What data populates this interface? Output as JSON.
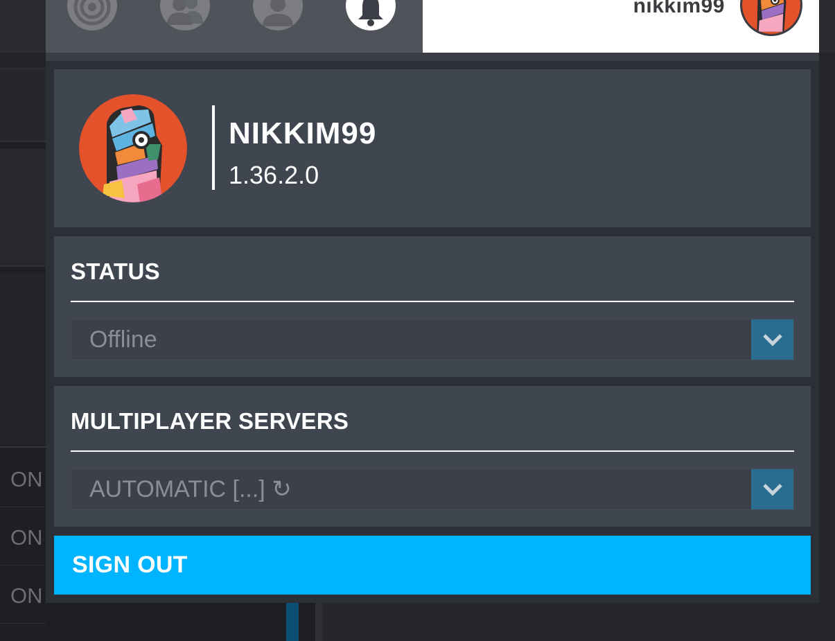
{
  "header": {
    "username": "nikkim99",
    "nav_icons": [
      "target-icon",
      "friends-icon",
      "profile-icon",
      "notifications-icon"
    ],
    "active_nav": "notifications-icon"
  },
  "profile": {
    "gamertag": "NIKKIM99",
    "version": "1.36.2.0"
  },
  "status": {
    "title": "STATUS",
    "selected": "Offline"
  },
  "multiplayer": {
    "title": "MULTIPLAYER SERVERS",
    "selected": "AUTOMATIC [...] ↻"
  },
  "sign_out": {
    "label": "SIGN OUT"
  },
  "background": {
    "row_labels": [
      "ON",
      "ON",
      "ON"
    ]
  },
  "colors": {
    "accent": "#00b4ff",
    "avatar_bg": "#e4522b",
    "dropdown_arrow": "#2a6d90",
    "card": "#404650"
  }
}
